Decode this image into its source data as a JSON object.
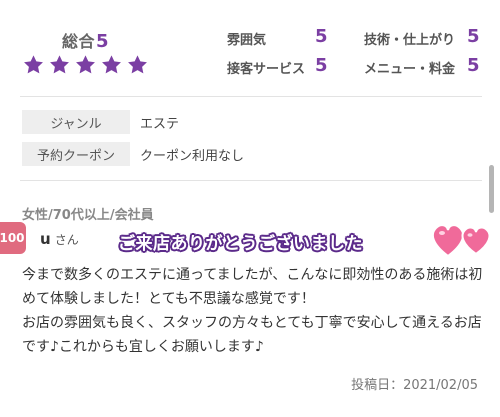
{
  "overall": {
    "label": "総合",
    "value": "5",
    "stars": 5
  },
  "sub_ratings": [
    {
      "label": "雰囲気",
      "value": "5"
    },
    {
      "label": "技術・仕上がり",
      "value": "5"
    },
    {
      "label": "接客サービス",
      "value": "5"
    },
    {
      "label": "メニュー・料金",
      "value": "5"
    }
  ],
  "info": [
    {
      "key": "ジャンル",
      "value": "エステ"
    },
    {
      "key": "予約クーポン",
      "value": "クーポン利用なし"
    }
  ],
  "review": {
    "reviewer_meta": "女性/70代以上/会社員",
    "badge": "100",
    "name": "u",
    "honorific": "さん",
    "thanks_overlay": "ご来店ありがとうございました",
    "body": "今まで数多くのエステに通ってましたが、こんなに即効性のある施術は初めて体験しました！とても不思議な感覚です！\nお店の雰囲気も良く、スタッフの方々もとても丁寧で安心して通えるお店です♪これからも宜しくお願いします♪",
    "post_date": "投稿日：2021/02/05"
  },
  "colors": {
    "accent": "#7b3fa3",
    "heart": "#f06a9a",
    "badge": "#e06b7f"
  }
}
